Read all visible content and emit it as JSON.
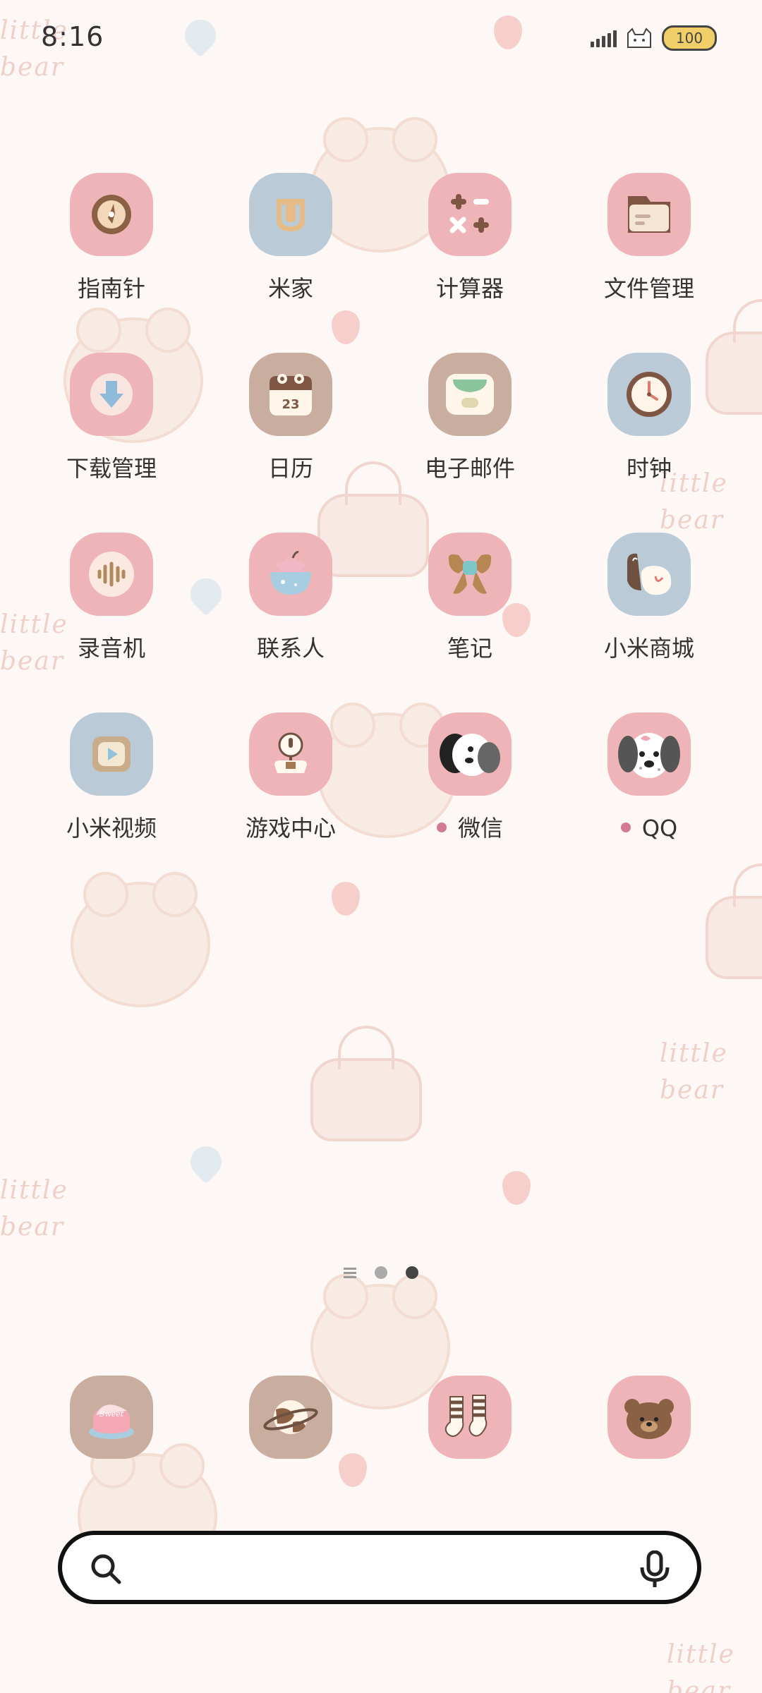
{
  "status_bar": {
    "time": "8:16",
    "battery": "100",
    "icons": [
      "signal-icon",
      "cat-icon",
      "battery-icon"
    ]
  },
  "wallpaper": {
    "text_top": "little\nbear",
    "text_1": "little\nbear",
    "text_2": "little\nbear",
    "text_3": "little\nbear",
    "text_4": "little\nbear",
    "text_5": "little\nbear"
  },
  "apps": [
    {
      "label": "指南针",
      "icon": "compass-icon",
      "color": "#efb4b7"
    },
    {
      "label": "米家",
      "icon": "mi-home-icon",
      "color": "#bacbd7"
    },
    {
      "label": "计算器",
      "icon": "calculator-icon",
      "color": "#efb4b7"
    },
    {
      "label": "文件管理",
      "icon": "file-manager-icon",
      "color": "#efb4b7"
    },
    {
      "label": "下载管理",
      "icon": "download-icon",
      "color": "#efb4b7"
    },
    {
      "label": "日历",
      "icon": "calendar-icon",
      "color": "#c9aea0",
      "calendar_day": "23"
    },
    {
      "label": "电子邮件",
      "icon": "email-icon",
      "color": "#c9aea0"
    },
    {
      "label": "时钟",
      "icon": "clock-icon",
      "color": "#bacbd7"
    },
    {
      "label": "录音机",
      "icon": "recorder-icon",
      "color": "#efb4b7"
    },
    {
      "label": "联系人",
      "icon": "contacts-icon",
      "color": "#efb4b7"
    },
    {
      "label": "笔记",
      "icon": "notes-icon",
      "color": "#efb4b7"
    },
    {
      "label": "小米商城",
      "icon": "mi-store-icon",
      "color": "#bacbd7"
    },
    {
      "label": "小米视频",
      "icon": "mi-video-icon",
      "color": "#bacbd7"
    },
    {
      "label": "游戏中心",
      "icon": "game-center-icon",
      "color": "#efb4b7"
    },
    {
      "label": "微信",
      "icon": "wechat-icon",
      "color": "#efb4b7",
      "new_dot": true
    },
    {
      "label": "QQ",
      "icon": "qq-icon",
      "color": "#efb4b7",
      "new_dot": true
    }
  ],
  "dock": [
    {
      "icon": "cake-icon",
      "color": "#c9aea0"
    },
    {
      "icon": "planet-icon",
      "color": "#c9aea0"
    },
    {
      "icon": "socks-icon",
      "color": "#efb4b7"
    },
    {
      "icon": "bear-icon",
      "color": "#efb4b7"
    }
  ],
  "page_indicator": {
    "pages": 2,
    "current": 2
  },
  "search": {
    "placeholder": "",
    "value": ""
  }
}
